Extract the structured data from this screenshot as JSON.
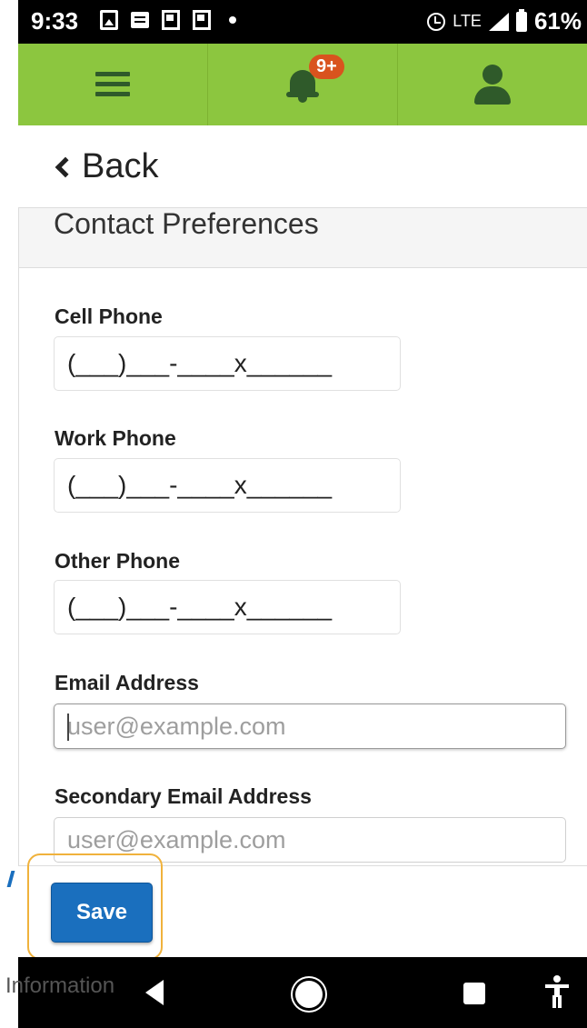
{
  "status_bar": {
    "time": "9:33",
    "network": "LTE",
    "battery": "61%"
  },
  "header": {
    "notification_count": "9+"
  },
  "back": {
    "label": "Back"
  },
  "panel": {
    "title": "Contact Preferences"
  },
  "form": {
    "cell_phone": {
      "label": "Cell Phone",
      "value": "(___)___-____x______"
    },
    "work_phone": {
      "label": "Work Phone",
      "value": "(___)___-____x______"
    },
    "other_phone": {
      "label": "Other Phone",
      "value": "(___)___-____x______"
    },
    "email": {
      "label": "Email Address",
      "placeholder": "user@example.com"
    },
    "secondary_email": {
      "label": "Secondary Email Address",
      "placeholder": "user@example.com"
    }
  },
  "actions": {
    "save_label": "Save"
  },
  "footer": {
    "info_text": "Information"
  },
  "colors": {
    "header_green": "#8cc63f",
    "icon_dark_green": "#2f5a2a",
    "badge_orange": "#d9531e",
    "save_blue": "#1a6fbe",
    "highlight_orange": "#f0b23c"
  }
}
